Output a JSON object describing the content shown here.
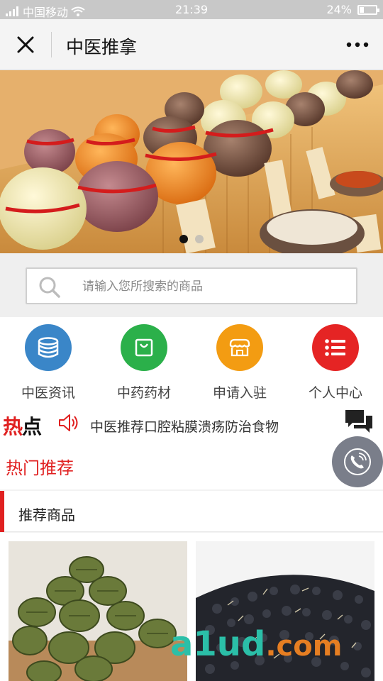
{
  "status_bar": {
    "carrier": "中国移动",
    "time": "21:39",
    "battery": "24%"
  },
  "nav": {
    "title": "中医推拿"
  },
  "banner": {
    "slide_count": 2,
    "active_slide": 0
  },
  "search": {
    "placeholder": "请输入您所搜索的商品"
  },
  "menu": {
    "items": [
      {
        "label": "中医资讯",
        "icon": "database-icon",
        "color": "#3a86c8"
      },
      {
        "label": "中药药材",
        "icon": "bag-icon",
        "color": "#2bb04a"
      },
      {
        "label": "申请入驻",
        "icon": "store-icon",
        "color": "#f39c12"
      },
      {
        "label": "个人中心",
        "icon": "list-icon",
        "color": "#e52424"
      }
    ]
  },
  "hot": {
    "badge_red": "热",
    "badge_black": "点",
    "headline": "中医推荐口腔粘膜溃疡防治食物"
  },
  "recommend": {
    "title": "热门推荐"
  },
  "section": {
    "title": "推荐商品"
  },
  "watermark": {
    "part1": "a1ud",
    "part2": ".com"
  },
  "colors": {
    "accent": "#e02020",
    "status_bar": "#c8c8c8"
  }
}
